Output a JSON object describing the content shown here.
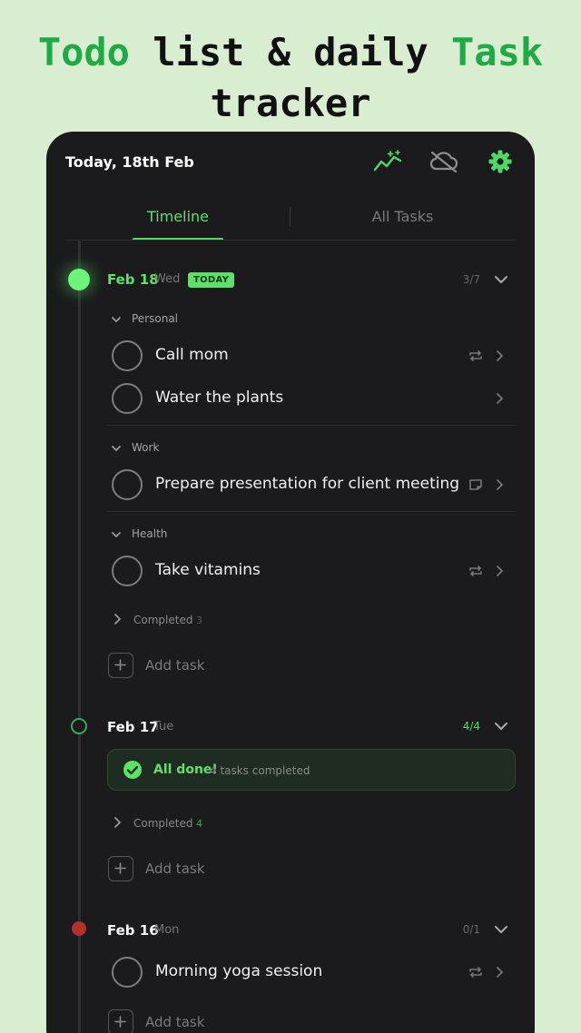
{
  "headline": {
    "w1": "Todo",
    "w2": "list & daily",
    "w3": "Task",
    "w4": "tracker"
  },
  "header": {
    "title": "Today, 18th Feb",
    "accent": "#4cd964"
  },
  "icons": {
    "stats": "sparkle-chart-icon",
    "cloud": "cloud-off-icon",
    "settings": "gear-icon"
  },
  "tabs": [
    {
      "label": "Timeline",
      "active": true
    },
    {
      "label": "All Tasks",
      "active": false
    }
  ],
  "days": [
    {
      "date": "Feb 18",
      "weekday": "Wed",
      "badge": "TODAY",
      "count": "3/7",
      "status": "today",
      "groups": [
        {
          "name": "Personal",
          "tasks": [
            {
              "title": "Call mom",
              "icon": "repeat-icon"
            },
            {
              "title": "Water the plants",
              "icon": ""
            }
          ]
        },
        {
          "name": "Work",
          "tasks": [
            {
              "title": "Prepare presentation for client meeting",
              "icon": "note-icon"
            }
          ]
        },
        {
          "name": "Health",
          "tasks": [
            {
              "title": "Take vitamins",
              "icon": "repeat-icon"
            }
          ]
        }
      ],
      "completed_label": "Completed",
      "completed_count": "3",
      "add_label": "Add task"
    },
    {
      "date": "Feb 17",
      "weekday": "Tue",
      "count": "4/4",
      "status": "done",
      "done_title": "All done!",
      "done_sub": "4 tasks completed",
      "completed_label": "Completed",
      "completed_count": "4",
      "add_label": "Add task"
    },
    {
      "date": "Feb 16",
      "weekday": "Mon",
      "count": "0/1",
      "status": "overdue",
      "tasks": [
        {
          "title": "Morning yoga session",
          "icon": "repeat-icon"
        }
      ],
      "add_label": "Add task"
    }
  ]
}
